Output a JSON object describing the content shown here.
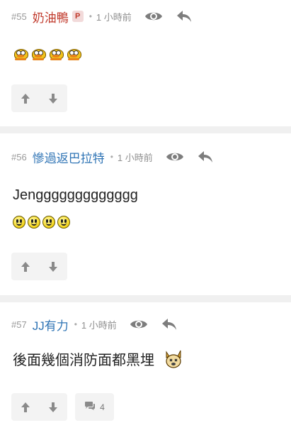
{
  "posts": [
    {
      "number": "#55",
      "author": "奶油鴨",
      "badge": "P",
      "time": "1 小時前",
      "text": "",
      "emojis": "duck x4"
    },
    {
      "number": "#56",
      "author": "慘過返巴拉特",
      "time": "1 小時前",
      "text": "Jenggggggggggggg",
      "emojis": "smiley x4"
    },
    {
      "number": "#57",
      "author": "JJ有力",
      "time": "1 小時前",
      "text": "後面幾個消防面都黑埋",
      "reply_count": "4"
    }
  ],
  "colors": {
    "author_op": "#c0392b",
    "author": "#2f74b5",
    "meta_grey": "#8f8f8f",
    "divider": "#f0f0f0"
  }
}
